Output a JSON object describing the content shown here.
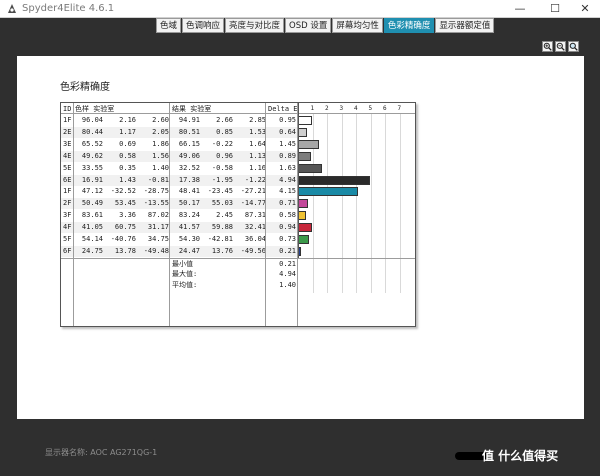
{
  "window": {
    "title": "Spyder4Elite 4.6.1",
    "minimize": "—",
    "maximize": "☐",
    "close": "✕"
  },
  "tabs": [
    {
      "label": "色域",
      "active": false
    },
    {
      "label": "色调响应",
      "active": false
    },
    {
      "label": "亮度与对比度",
      "active": false
    },
    {
      "label": "OSD 设置",
      "active": false
    },
    {
      "label": "屏幕均匀性",
      "active": false
    },
    {
      "label": "色彩精确度",
      "active": true
    },
    {
      "label": "显示器额定值",
      "active": false
    }
  ],
  "zoom_tools": [
    "zoom-in-icon",
    "zoom-out-icon",
    "zoom-fit-icon"
  ],
  "report": {
    "title": "色彩精确度",
    "headers": {
      "id": "ID",
      "sample_group": "色样 实验室",
      "result_group": "结果 实验室",
      "delta_e": "Delta E"
    },
    "axis_ticks": [
      "1",
      "2",
      "3",
      "4",
      "5",
      "6",
      "7"
    ],
    "rows": [
      {
        "id": "1F",
        "ref": [
          "96.04",
          "2.16",
          "2.60"
        ],
        "res": [
          "94.91",
          "2.66",
          "2.85"
        ],
        "de": "0.95",
        "value": 0.95,
        "color": "#ffffff"
      },
      {
        "id": "2E",
        "ref": [
          "80.44",
          "1.17",
          "2.05"
        ],
        "res": [
          "80.51",
          "0.85",
          "1.53"
        ],
        "de": "0.64",
        "value": 0.64,
        "color": "#cfcfcf"
      },
      {
        "id": "3E",
        "ref": [
          "65.52",
          "0.69",
          "1.86"
        ],
        "res": [
          "66.15",
          "-0.22",
          "1.64"
        ],
        "de": "1.45",
        "value": 1.45,
        "color": "#a7a7a7"
      },
      {
        "id": "4E",
        "ref": [
          "49.62",
          "0.58",
          "1.56"
        ],
        "res": [
          "49.06",
          "0.96",
          "1.13"
        ],
        "de": "0.89",
        "value": 0.89,
        "color": "#7d7d7d"
      },
      {
        "id": "5E",
        "ref": [
          "33.55",
          "0.35",
          "1.40"
        ],
        "res": [
          "32.52",
          "-0.58",
          "1.16",
          "1.63"
        ],
        "de": "1.63",
        "value": 1.63,
        "color": "#565656"
      },
      {
        "id": "6E",
        "ref": [
          "16.91",
          "1.43",
          "-0.81"
        ],
        "res": [
          "17.38",
          "-1.95",
          "-1.22"
        ],
        "de": "4.94",
        "value": 4.94,
        "color": "#2a2a2a"
      },
      {
        "id": "1F",
        "ref": [
          "47.12",
          "-32.52",
          "-28.75"
        ],
        "res": [
          "48.41",
          "-23.45",
          "-27.21"
        ],
        "de": "4.15",
        "value": 4.15,
        "color": "#1a8aa6"
      },
      {
        "id": "2F",
        "ref": [
          "50.49",
          "53.45",
          "-13.55"
        ],
        "res": [
          "50.17",
          "55.03",
          "-14.77"
        ],
        "de": "0.71",
        "value": 0.71,
        "color": "#c2489a"
      },
      {
        "id": "3F",
        "ref": [
          "83.61",
          "3.36",
          "87.02"
        ],
        "res": [
          "83.24",
          "2.45",
          "87.31"
        ],
        "de": "0.58",
        "value": 0.58,
        "color": "#efc233"
      },
      {
        "id": "4F",
        "ref": [
          "41.05",
          "60.75",
          "31.17"
        ],
        "res": [
          "41.57",
          "59.88",
          "32.41"
        ],
        "de": "0.94",
        "value": 0.94,
        "color": "#c7273b"
      },
      {
        "id": "5F",
        "ref": [
          "54.14",
          "-40.76",
          "34.75"
        ],
        "res": [
          "54.30",
          "-42.81",
          "36.04",
          ""
        ],
        "de": "0.73",
        "value": 0.73,
        "color": "#3c9a4a"
      },
      {
        "id": "6F",
        "ref": [
          "24.75",
          "13.78",
          "-49.48"
        ],
        "res": [
          "24.47",
          "13.76",
          "-49.56"
        ],
        "de": "0.21",
        "value": 0.21,
        "color": "#253f8e"
      }
    ],
    "summary": [
      {
        "label": "最小值",
        "value": "0.21"
      },
      {
        "label": "最大值:",
        "value": "4.94"
      },
      {
        "label": "平均值:",
        "value": "1.40"
      }
    ]
  },
  "status": {
    "monitor_name": "显示器名称: AOC AG271QG-1"
  },
  "watermark": "值 什么值得买"
}
